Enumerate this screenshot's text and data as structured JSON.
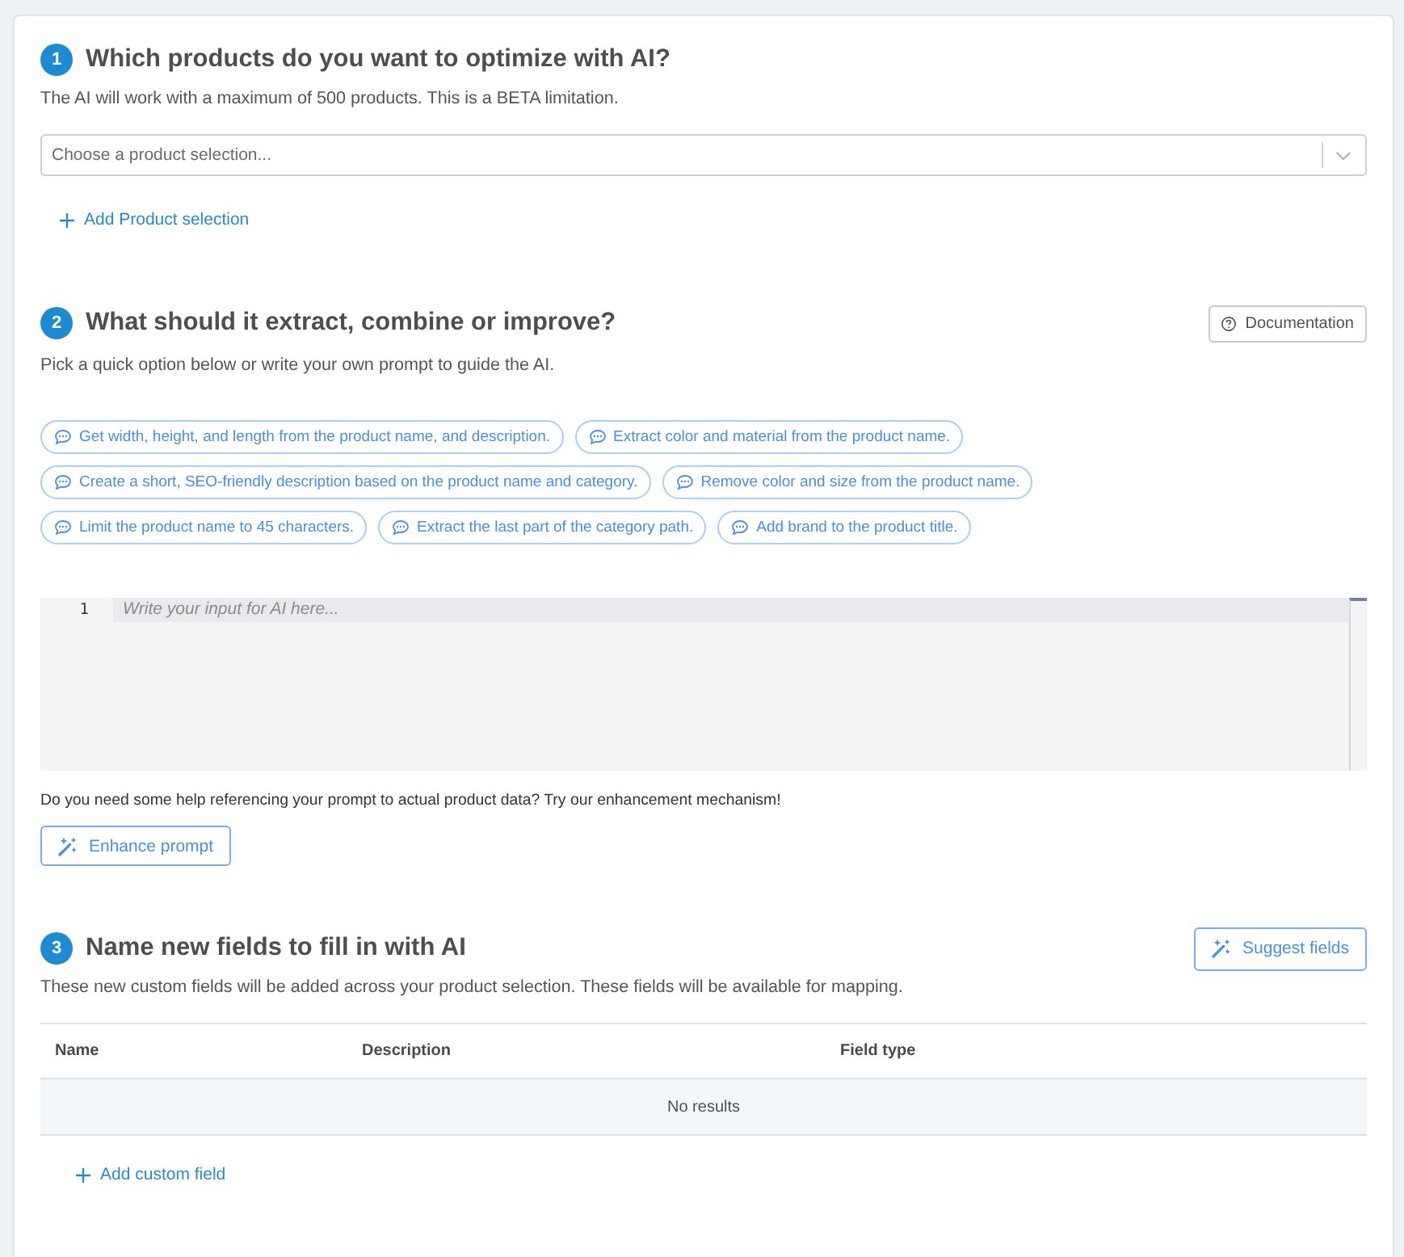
{
  "product_section": {
    "step": "1",
    "title": "Which products do you want to optimize with AI?",
    "description": "The AI will work with a maximum of 500 products. This is a BETA limitation.",
    "product_select": {
      "placeholder": "Choose a product selection..."
    },
    "add_link": {
      "label": "Add Product selection"
    }
  },
  "prompt_section": {
    "step": "2",
    "title": "What should it extract, combine or improve?",
    "description": "Pick a quick option below or write your own prompt to guide the AI.",
    "documentation_button": {
      "label": "Documentation"
    },
    "quick_options": [
      "Get width, height, and length from the product name, and description.",
      "Extract color and material from the product name.",
      "Create a short, SEO-friendly description based on the product name and category.",
      "Remove color and size from the product name.",
      "Limit the product name to 45 characters.",
      "Extract the last part of the category path.",
      "Add brand to the product title."
    ],
    "prompt_editor": {
      "line_number": "1",
      "placeholder": "Write your input for AI here..."
    },
    "help_text": "Do you need some help referencing your prompt to actual product data? Try our enhancement mechanism!",
    "enhance_button": {
      "label": "Enhance prompt"
    }
  },
  "fields_section": {
    "step": "3",
    "title": "Name new fields to fill in with AI",
    "description": "These new custom fields will be added across your product selection. These fields will be available for mapping.",
    "suggest_button": {
      "label": "Suggest fields"
    },
    "table": {
      "columns": [
        "Name",
        "Description",
        "Field type"
      ],
      "empty_message": "No results"
    },
    "add_link": {
      "label": "Add custom field"
    }
  }
}
